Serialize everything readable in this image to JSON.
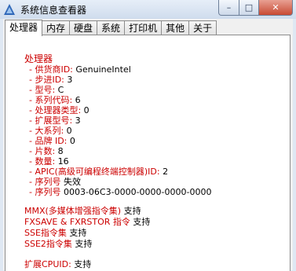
{
  "window": {
    "title": "系统信息查看器",
    "minimize": "–",
    "maximize": "□",
    "close": "✕"
  },
  "tabs": [
    "处理器",
    "内存",
    "硬盘",
    "系统",
    "打印机",
    "其他",
    "关于"
  ],
  "processor": {
    "heading": "处理器",
    "rows": [
      {
        "label": "- 供货商ID:",
        "value": "GenuineIntel"
      },
      {
        "label": "- 步进ID:",
        "value": "3"
      },
      {
        "label": "- 型号:",
        "value": "C"
      },
      {
        "label": "- 系列代码:",
        "value": "6"
      },
      {
        "label": "- 处理器类型:",
        "value": "0"
      },
      {
        "label": "- 扩展型号:",
        "value": "3"
      },
      {
        "label": "- 大系列:",
        "value": "0"
      },
      {
        "label": "- 品牌 ID:",
        "value": "0"
      },
      {
        "label": "- 片数:",
        "value": "8"
      },
      {
        "label": "- 数量:",
        "value": "16"
      },
      {
        "label": "- APIC(高级可编程终端控制器)ID:",
        "value": "2"
      },
      {
        "label": "- 序列号",
        "value": "失效"
      },
      {
        "label": "- 序列号",
        "value": "0003-06C3-0000-0000-0000-0000"
      }
    ],
    "features": [
      {
        "label": "MMX(多媒体增强指令集)",
        "value": "支持"
      },
      {
        "label": "FXSAVE & FXRSTOR 指令",
        "value": "支持"
      },
      {
        "label": "SSE指令集",
        "value": "支持"
      },
      {
        "label": "SSE2指令集",
        "value": "支持"
      }
    ],
    "extended": {
      "label": "扩展CPUID:",
      "value": "支持"
    }
  }
}
